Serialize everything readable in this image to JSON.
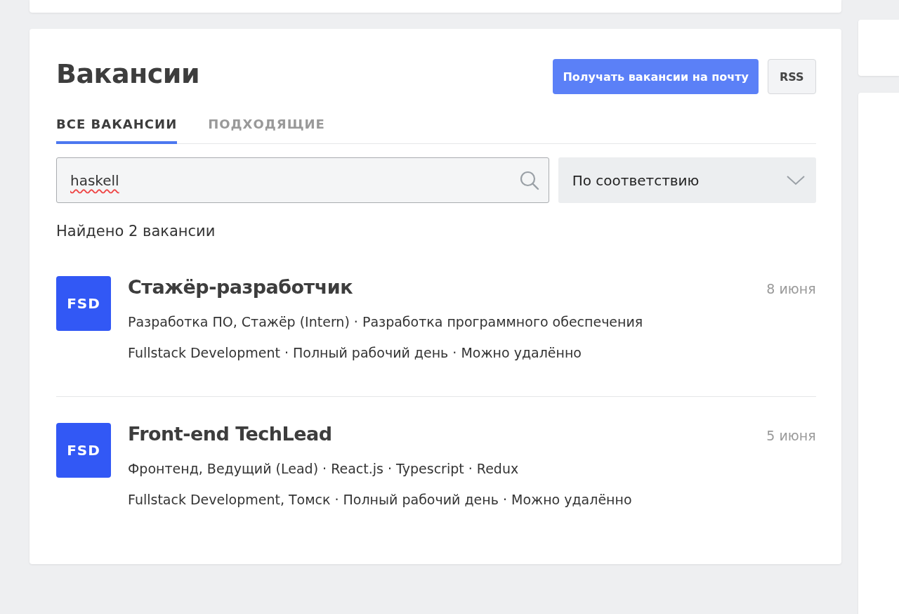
{
  "header": {
    "title": "Вакансии",
    "subscribe_button": "Получать вакансии на почту",
    "rss_button": "RSS"
  },
  "tabs": [
    {
      "label": "ВСЕ ВАКАНСИИ",
      "selected": true
    },
    {
      "label": "ПОДХОДЯЩИЕ",
      "selected": false
    }
  ],
  "search": {
    "value": "haskell"
  },
  "sort": {
    "value": "По соответствию"
  },
  "found": "Найдено 2 вакансии",
  "jobs": [
    {
      "logo": "FSD",
      "title": "Стажёр-разработчик",
      "date": "8 июня",
      "lines": [
        "Разработка ПО, Стажёр (Intern) · Разработка программного обеспечения",
        "Fullstack Development · Полный рабочий день · Можно удалённо"
      ]
    },
    {
      "logo": "FSD",
      "title": "Front-end TechLead",
      "date": "5 июня",
      "lines": [
        "Фронтенд, Ведущий (Lead) · React.js · Typescript · Redux",
        "Fullstack Development, Томск · Полный рабочий день · Можно удалённо"
      ]
    }
  ]
}
